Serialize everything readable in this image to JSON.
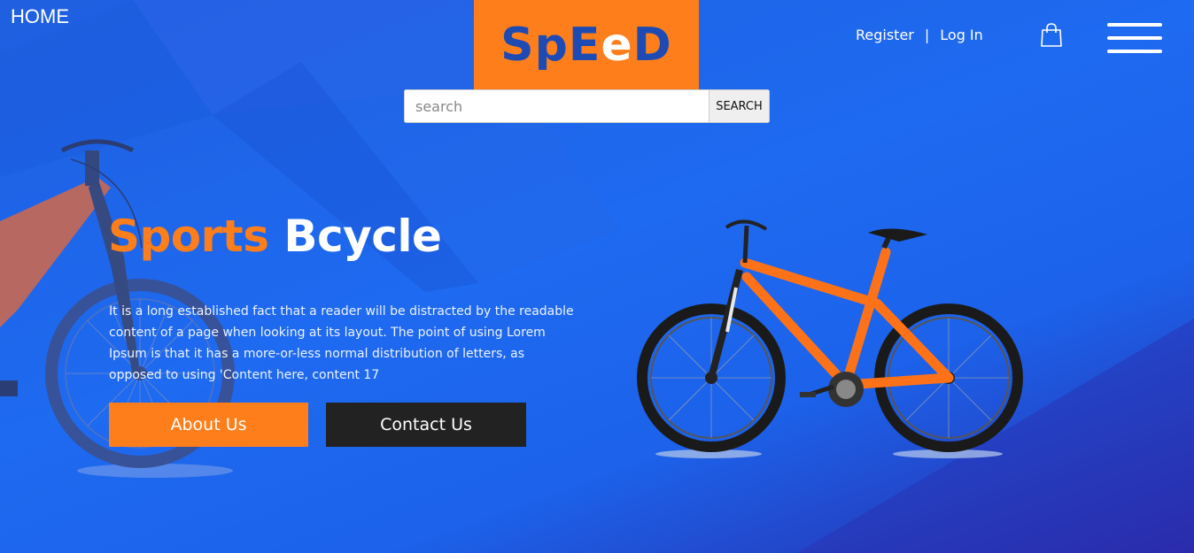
{
  "nav": {
    "home_label": "HOME",
    "register_label": "Register",
    "separator": "|",
    "login_label": "Log In"
  },
  "logo": {
    "part1": "SpE",
    "part2": "e",
    "part3": "D"
  },
  "search": {
    "placeholder": "search",
    "value": "",
    "button_label": "SEARCH"
  },
  "hero": {
    "title_accent": "Sports",
    "title_main": "Bcycle",
    "paragraph": "It is a long established fact that a reader will be distracted by the readable content of a page when looking at its layout. The point of using Lorem Ipsum is that it has a more-or-less normal distribution of letters, as opposed to using 'Content here, content 17",
    "about_label": "About Us",
    "contact_label": "Contact Us"
  },
  "icons": {
    "cart": "shopping-bag-icon",
    "menu": "hamburger-menu-icon"
  },
  "colors": {
    "accent": "#fd7e1b",
    "logo_blue": "#1d4bb3",
    "background": "#1e6af0",
    "dark_button": "#222222"
  }
}
